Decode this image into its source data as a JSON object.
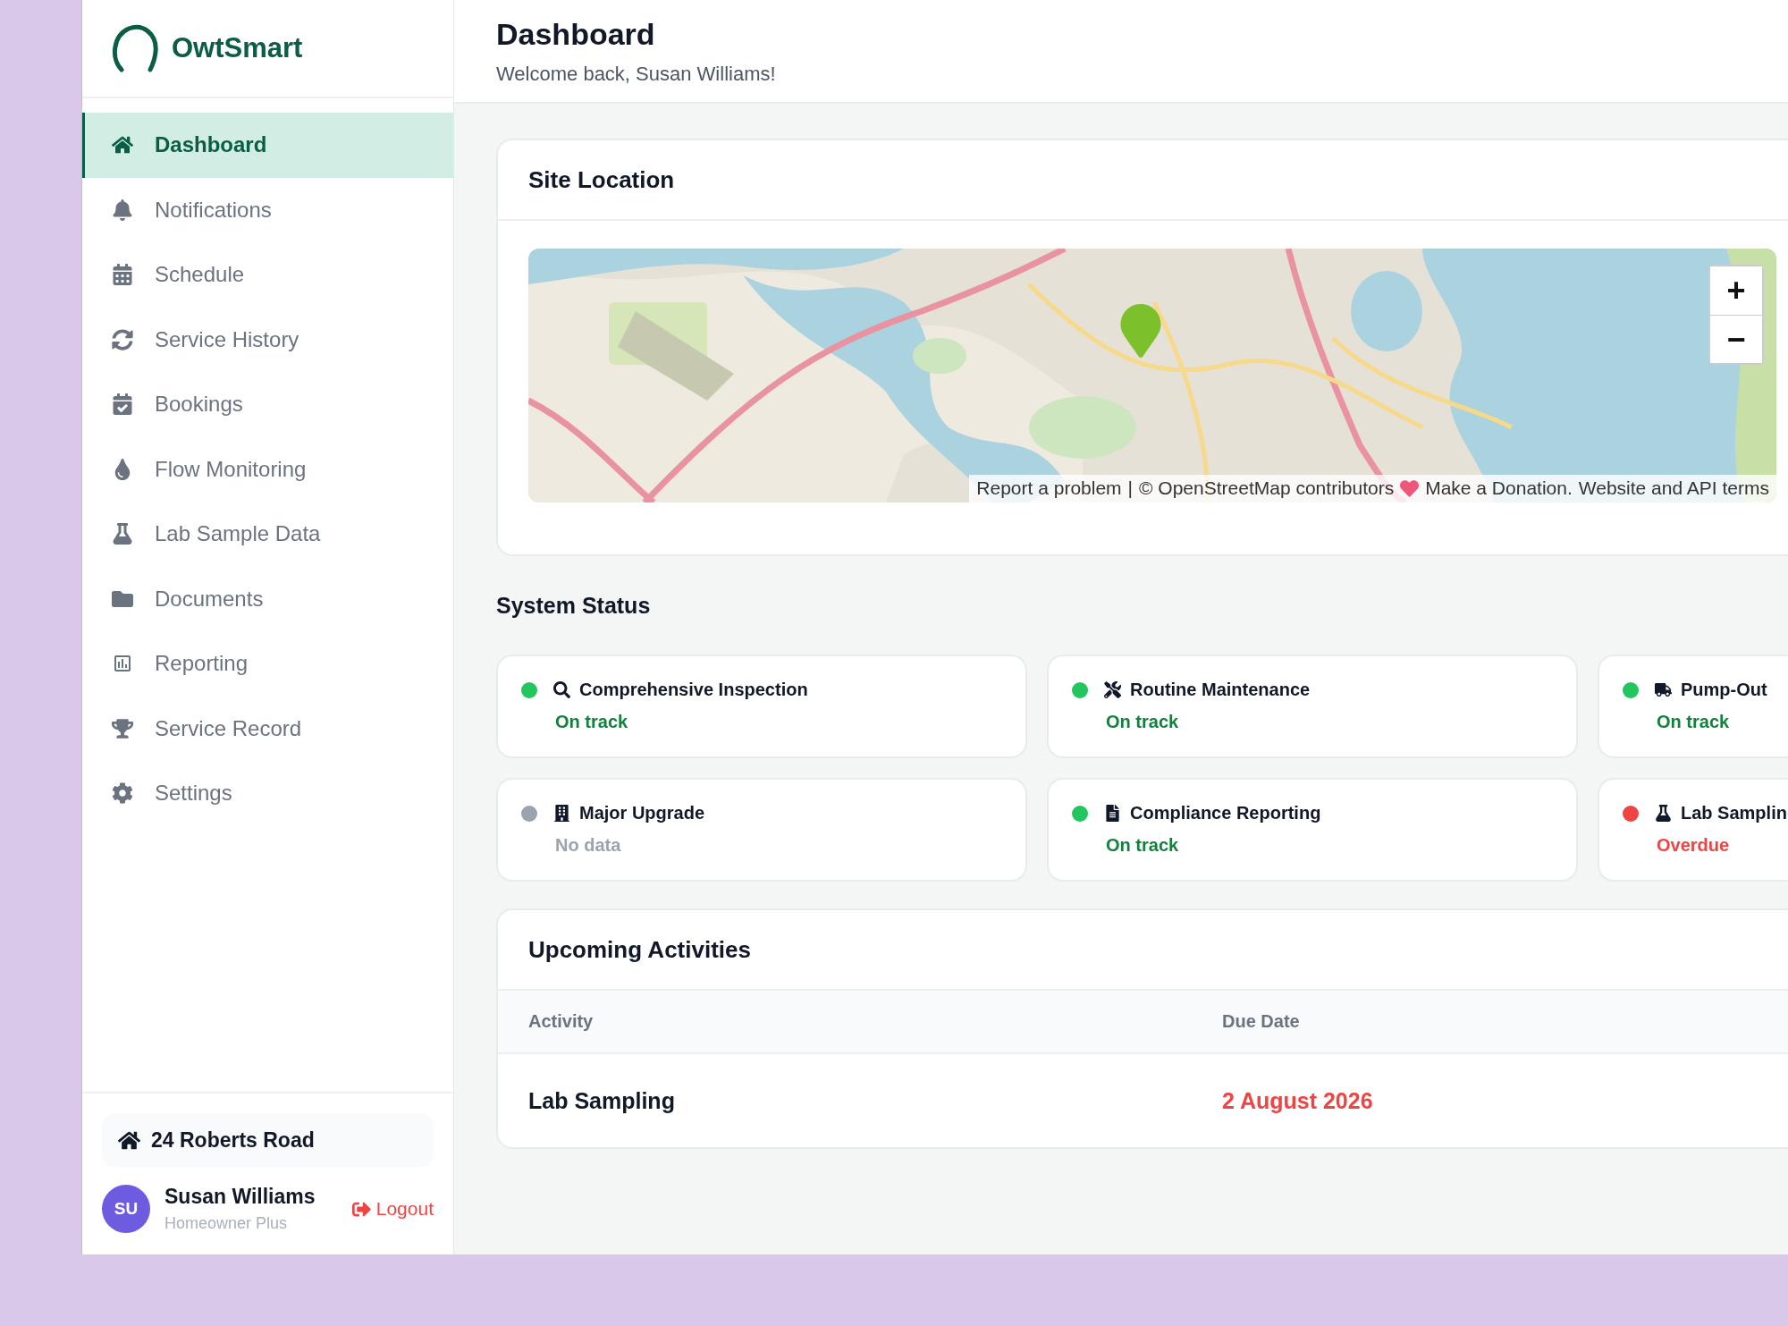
{
  "brand": {
    "name": "OwtSmart"
  },
  "nav": [
    {
      "label": "Dashboard",
      "selected": true
    },
    {
      "label": "Notifications",
      "selected": false
    },
    {
      "label": "Schedule",
      "selected": false
    },
    {
      "label": "Service History",
      "selected": false
    },
    {
      "label": "Bookings",
      "selected": false
    },
    {
      "label": "Flow Monitoring",
      "selected": false
    },
    {
      "label": "Lab Sample Data",
      "selected": false
    },
    {
      "label": "Documents",
      "selected": false
    },
    {
      "label": "Reporting",
      "selected": false
    },
    {
      "label": "Service Record",
      "selected": false
    },
    {
      "label": "Settings",
      "selected": false
    }
  ],
  "property": {
    "address": "24 Roberts Road"
  },
  "user": {
    "initials": "SU",
    "name": "Susan Williams",
    "plan": "Homeowner Plus",
    "logout": "Logout"
  },
  "header": {
    "title": "Dashboard",
    "subtitle": "Welcome back, Susan Williams!"
  },
  "site_location": {
    "title": "Site Location",
    "map": {
      "kind": "picture",
      "zoom_in": "+",
      "zoom_out": "−",
      "attribution": {
        "report": "Report a problem",
        "separator": "|",
        "osm": "© OpenStreetMap contributors",
        "donate": "Make a Donation.",
        "terms": "Website and API terms"
      }
    }
  },
  "system_status": {
    "title": "System Status",
    "items": [
      {
        "name": "Comprehensive Inspection",
        "status": "On track",
        "color": "#22c55e"
      },
      {
        "name": "Routine Maintenance",
        "status": "On track",
        "color": "#22c55e"
      },
      {
        "name": "Pump-Out",
        "status": "On track",
        "color": "#22c55e"
      },
      {
        "name": "Major Upgrade",
        "status": "No data",
        "color": "#9ca3af"
      },
      {
        "name": "Compliance Reporting",
        "status": "On track",
        "color": "#22c55e"
      },
      {
        "name": "Lab Samplin",
        "status": "Overdue",
        "color": "#ef4444"
      }
    ]
  },
  "upcoming": {
    "title": "Upcoming Activities",
    "columns": [
      "Activity",
      "Due Date"
    ],
    "rows": [
      {
        "activity": "Lab Sampling",
        "due_date": "2 August 2026",
        "overdue": true
      }
    ]
  }
}
